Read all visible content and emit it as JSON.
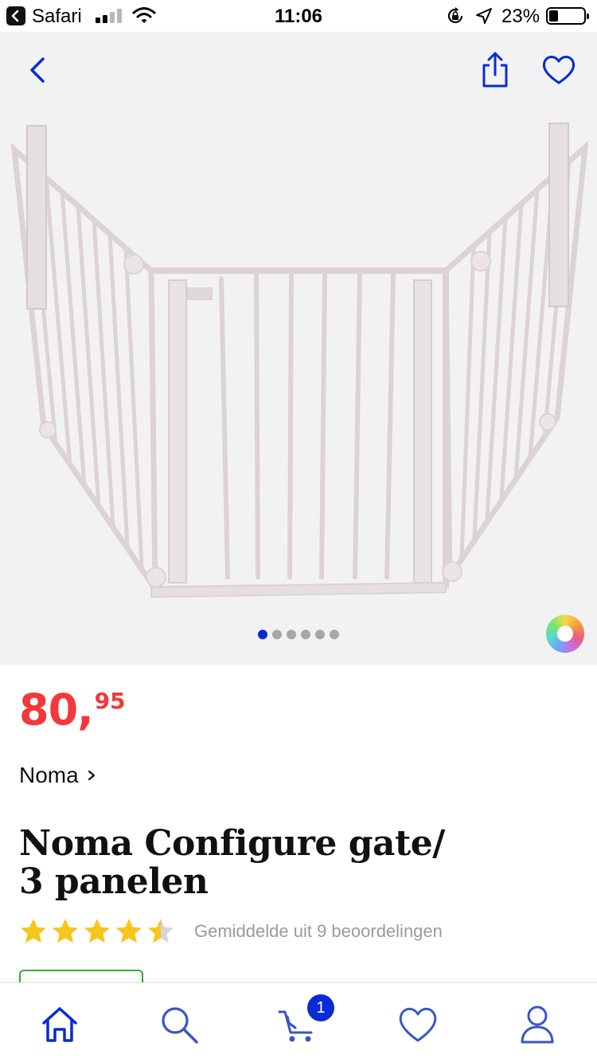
{
  "status_bar": {
    "app_name": "Safari",
    "time": "11:06",
    "battery_percent": "23%",
    "battery_level": 0.23
  },
  "gallery": {
    "image_description_icon": "gate-product-image",
    "dot_count": 6,
    "active_dot": 0
  },
  "product": {
    "price_euros": "80,",
    "price_cents": "95",
    "brand": "Noma",
    "title_line1": "Noma Configure gate/",
    "title_line2": "3 panelen",
    "rating_value": 4.5,
    "rating_max": 5,
    "rating_text": "Gemiddelde uit 9 beoordelingen"
  },
  "tabbar": {
    "cart_badge": "1"
  },
  "colors": {
    "accent": "#0a2ad6",
    "price": "#f3373b",
    "star": "#f7c51b",
    "star_empty": "#d6d6d6",
    "success": "#3aa935"
  }
}
